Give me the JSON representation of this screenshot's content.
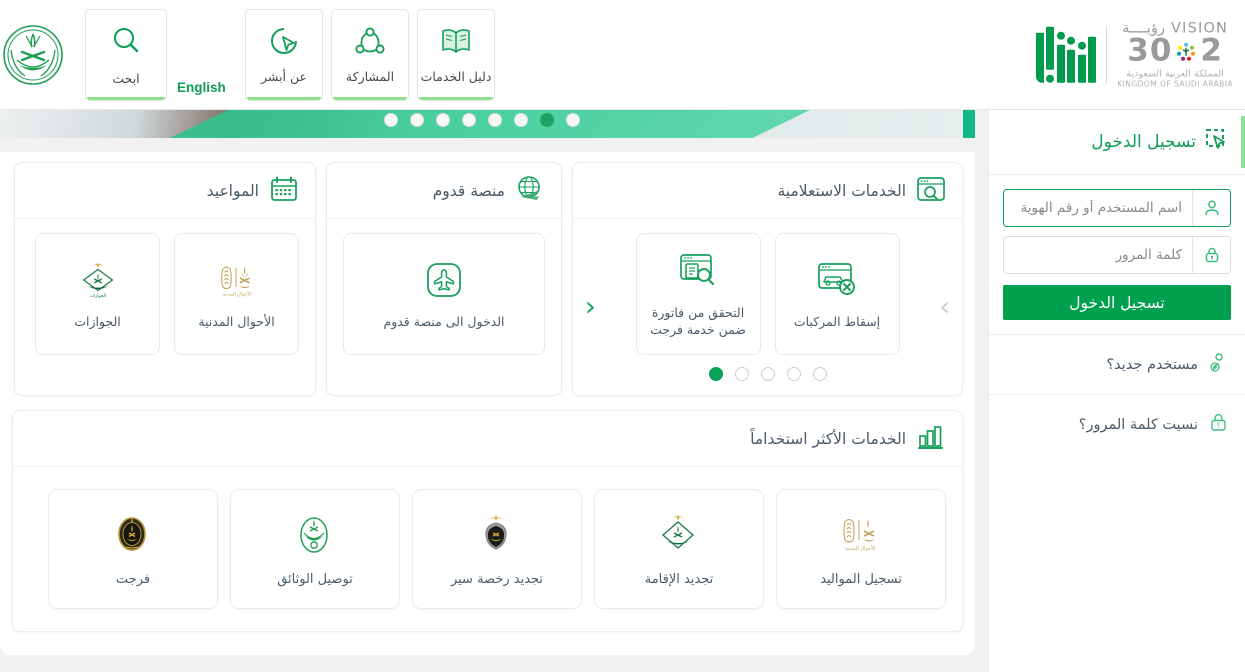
{
  "header": {
    "search": {
      "label": "ابحث",
      "icon": "search-icon"
    },
    "english_link": "English",
    "nav": [
      {
        "label": "دليل الخدمات",
        "icon": "book-icon"
      },
      {
        "label": "المشاركة",
        "icon": "share-icon"
      },
      {
        "label": "عن أبشر",
        "icon": "cursor-circle-icon"
      }
    ],
    "vision": {
      "word_en": "VISION",
      "word_ar": "رؤيــــة",
      "year_left": "2",
      "year_right": "30",
      "sub_ar": "المملكة العربية السعودية",
      "sub_en": "KINGDOM OF SAUDI ARABIA"
    },
    "absher_logo": "absher-logo"
  },
  "banner": {
    "dots_total": 8,
    "active_dot": 2
  },
  "appointments": {
    "title": "المواعيد",
    "icon": "calendar-icon",
    "items": [
      {
        "label": "الأحوال المدنية",
        "icon": "civil-affairs-emblem"
      },
      {
        "label": "الجوازات",
        "icon": "passports-emblem"
      }
    ]
  },
  "qudum": {
    "title": "منصة قدوم",
    "icon": "globe-plane-icon",
    "items": [
      {
        "label": "الدخول الى منصة قدوم",
        "icon": "airplane-icon"
      }
    ]
  },
  "inquiry": {
    "title": "الخدمات الاستعلامية",
    "icon": "browser-search-icon",
    "items": [
      {
        "label": "إسقاط المركبات",
        "icon": "vehicle-remove-icon"
      },
      {
        "label": "التحقق من فاتورة ضمن خدمة فرجت",
        "icon": "invoice-search-icon"
      }
    ],
    "arrow_prev": "‹",
    "arrow_next": "›",
    "dots_total": 5,
    "active_dot": 5
  },
  "most_used": {
    "title": "الخدمات الأكثر استخداماً",
    "icon": "bar-chart-icon",
    "items": [
      {
        "label": "تسجيل المواليد",
        "icon": "civil-affairs-emblem"
      },
      {
        "label": "تجديد الإقامة",
        "icon": "passports-emblem"
      },
      {
        "label": "تجديد رخصة سير",
        "icon": "traffic-emblem"
      },
      {
        "label": "توصيل الوثائق",
        "icon": "saudi-post-emblem"
      },
      {
        "label": "فرجت",
        "icon": "furijat-emblem"
      }
    ]
  },
  "login": {
    "title": "تسجيل الدخول",
    "title_icon": "cursor-select-icon",
    "username": {
      "value": "",
      "placeholder": "اسم المستخدم أو رقم الهوية",
      "icon": "user-icon"
    },
    "password": {
      "value": "",
      "placeholder": "كلمة المرور",
      "icon": "lock-icon"
    },
    "submit_label": "تسجيل الدخول",
    "links": [
      {
        "label": "مستخدم جديد؟",
        "icon": "user-add-icon"
      },
      {
        "label": "نسيت كلمة المرور؟",
        "icon": "lock-question-icon"
      }
    ]
  },
  "colors": {
    "brand_green": "#00a04e",
    "accent_green": "#0f9d58",
    "icon_green": "#3fbf7f",
    "text_slate": "#4a5a6a",
    "gold": "#bfa05a",
    "vision_gray": "#9a9a9a"
  }
}
